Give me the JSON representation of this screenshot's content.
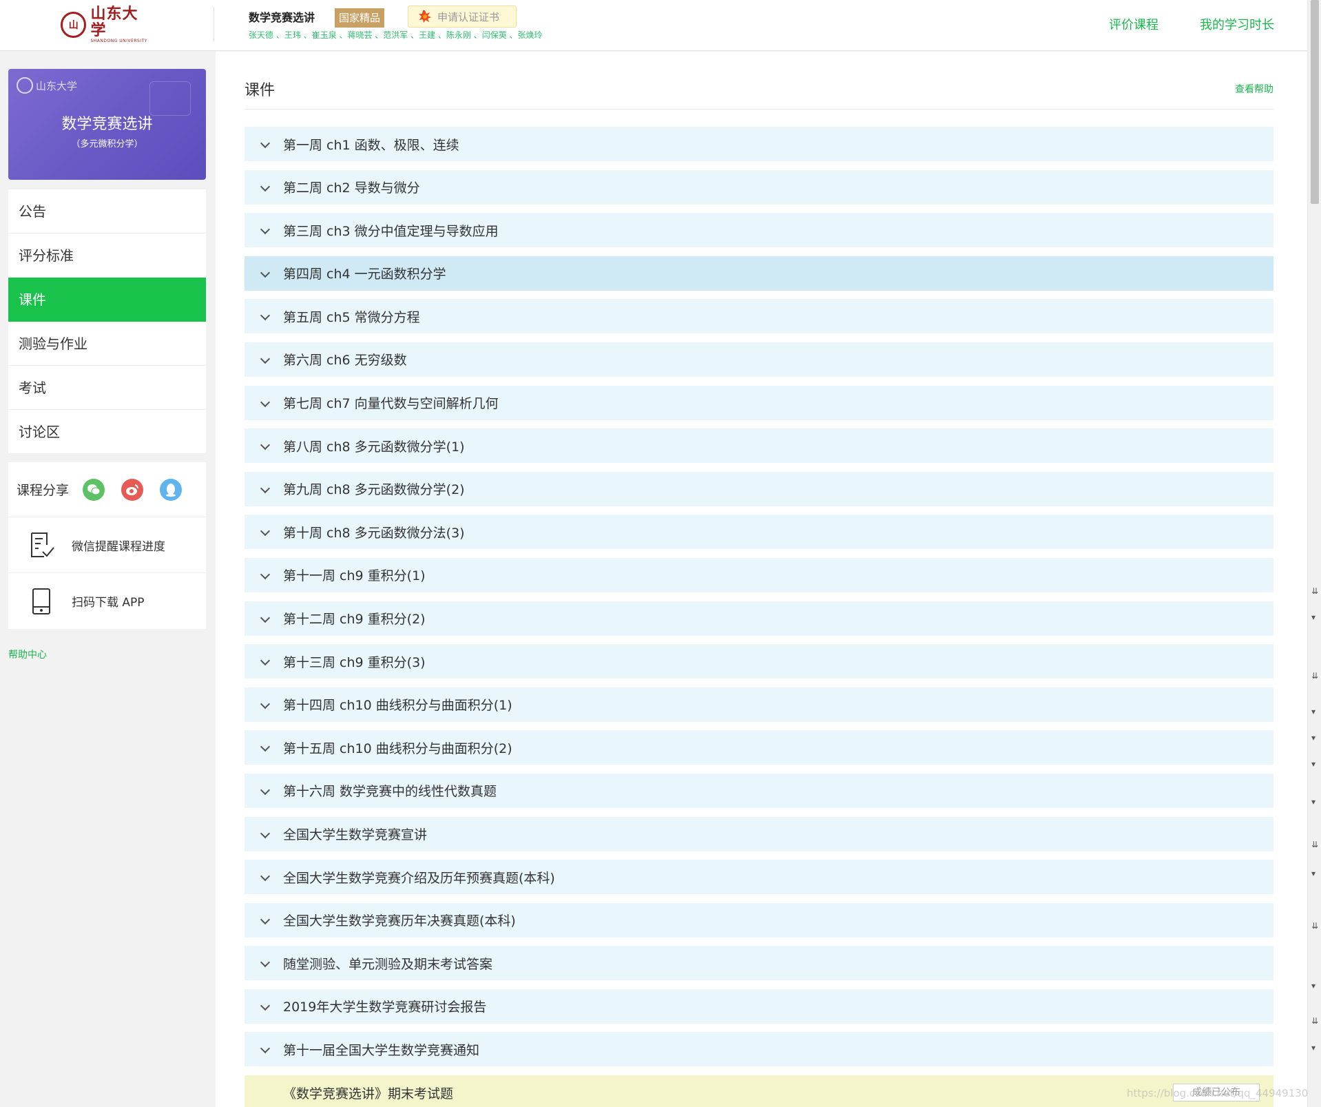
{
  "header": {
    "logo_cn": "山东大学",
    "logo_en": "SHANDONG UNIVERSITY",
    "course_title": "数学竞赛选讲",
    "badge": "国家精品",
    "cert_button": "申请认证证书",
    "teachers": "张天德 、王玮 、崔玉泉 、蒋晓芸 、范洪军 、王建 、陈永刚 、闫保英 、张焕玲",
    "links": [
      "评价课程",
      "我的学习时长"
    ]
  },
  "sidebar": {
    "card_title": "数学竞赛选讲",
    "card_subtitle": "（多元微积分学）",
    "card_logo": "山东大学",
    "nav": [
      "公告",
      "评分标准",
      "课件",
      "测验与作业",
      "考试",
      "讨论区"
    ],
    "active_nav": "课件",
    "share_label": "课程分享",
    "tools": [
      "微信提醒课程进度",
      "扫码下载 APP"
    ],
    "help_center": "帮助中心"
  },
  "main": {
    "title": "课件",
    "help_link": "查看帮助",
    "chapters": [
      "第一周 ch1 函数、极限、连续",
      "第二周 ch2 导数与微分",
      "第三周 ch3 微分中值定理与导数应用",
      "第四周 ch4 一元函数积分学",
      "第五周 ch5 常微分方程",
      "第六周 ch6 无穷级数",
      "第七周 ch7 向量代数与空间解析几何",
      "第八周 ch8 多元函数微分学(1)",
      "第九周 ch8 多元函数微分学(2)",
      "第十周 ch8 多元函数微分法(3)",
      "第十一周 ch9 重积分(1)",
      "第十二周 ch9 重积分(2)",
      "第十三周 ch9 重积分(3)",
      "第十四周 ch10 曲线积分与曲面积分(1)",
      "第十五周 ch10 曲线积分与曲面积分(2)",
      "第十六周 数学竞赛中的线性代数真题",
      "全国大学生数学竞赛宣讲",
      "全国大学生数学竞赛介绍及历年预赛真题(本科)",
      "全国大学生数学竞赛历年决赛真题(本科)",
      "随堂测验、单元测验及期末考试答案",
      "2019年大学生数学竞赛研讨会报告",
      "第十一届全国大学生数学竞赛通知"
    ],
    "exam_item": "《数学竞赛选讲》期末考试题",
    "exam_status": "成绩已公布"
  },
  "watermark": "https://blog.csdn.net/qq_44949130",
  "colors": {
    "accent_green": "#19c24a",
    "chapter_bg": "#e9f7fd",
    "chapter_hover_bg": "#cfeaf4",
    "exam_bg": "#f5f5cc",
    "card_purple": "#6a5ac6",
    "badge_gold": "#c9a063"
  }
}
